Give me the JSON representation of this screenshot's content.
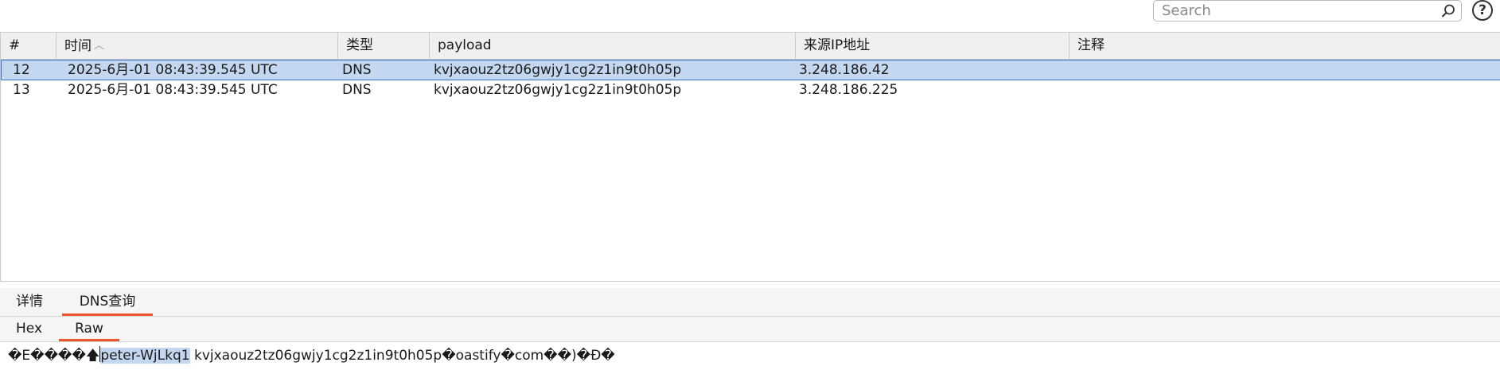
{
  "search": {
    "placeholder": "Search"
  },
  "help": {
    "glyph": "?"
  },
  "table": {
    "columns": [
      "#",
      "时间",
      "类型",
      "payload",
      "来源IP地址",
      "注释"
    ],
    "rows": [
      {
        "num": "12",
        "time": "2025-6月-01 08:43:39.545 UTC",
        "type": "DNS",
        "payload": "kvjxaouz2tz06gwjy1cg2z1in9t0h05p",
        "ip": "3.248.186.42",
        "note": ""
      },
      {
        "num": "13",
        "time": "2025-6月-01 08:43:39.545 UTC",
        "type": "DNS",
        "payload": "kvjxaouz2tz06gwjy1cg2z1in9t0h05p",
        "ip": "3.248.186.225",
        "note": ""
      }
    ]
  },
  "detail_tabs": [
    "详情",
    "DNS查询"
  ],
  "view_tabs": [
    "Hex",
    "Raw"
  ],
  "raw": {
    "prefix": "�E����",
    "arrow": "🡅",
    "selected": "peter-WjLkq1",
    "rest": " kvjxaouz2tz06gwjy1cg2z1in9t0h05p�oastify�com��)�Ð�"
  },
  "colors": {
    "accent": "#e8562a",
    "selection": "#c4d7f0",
    "selection_border": "#3b72c4"
  }
}
